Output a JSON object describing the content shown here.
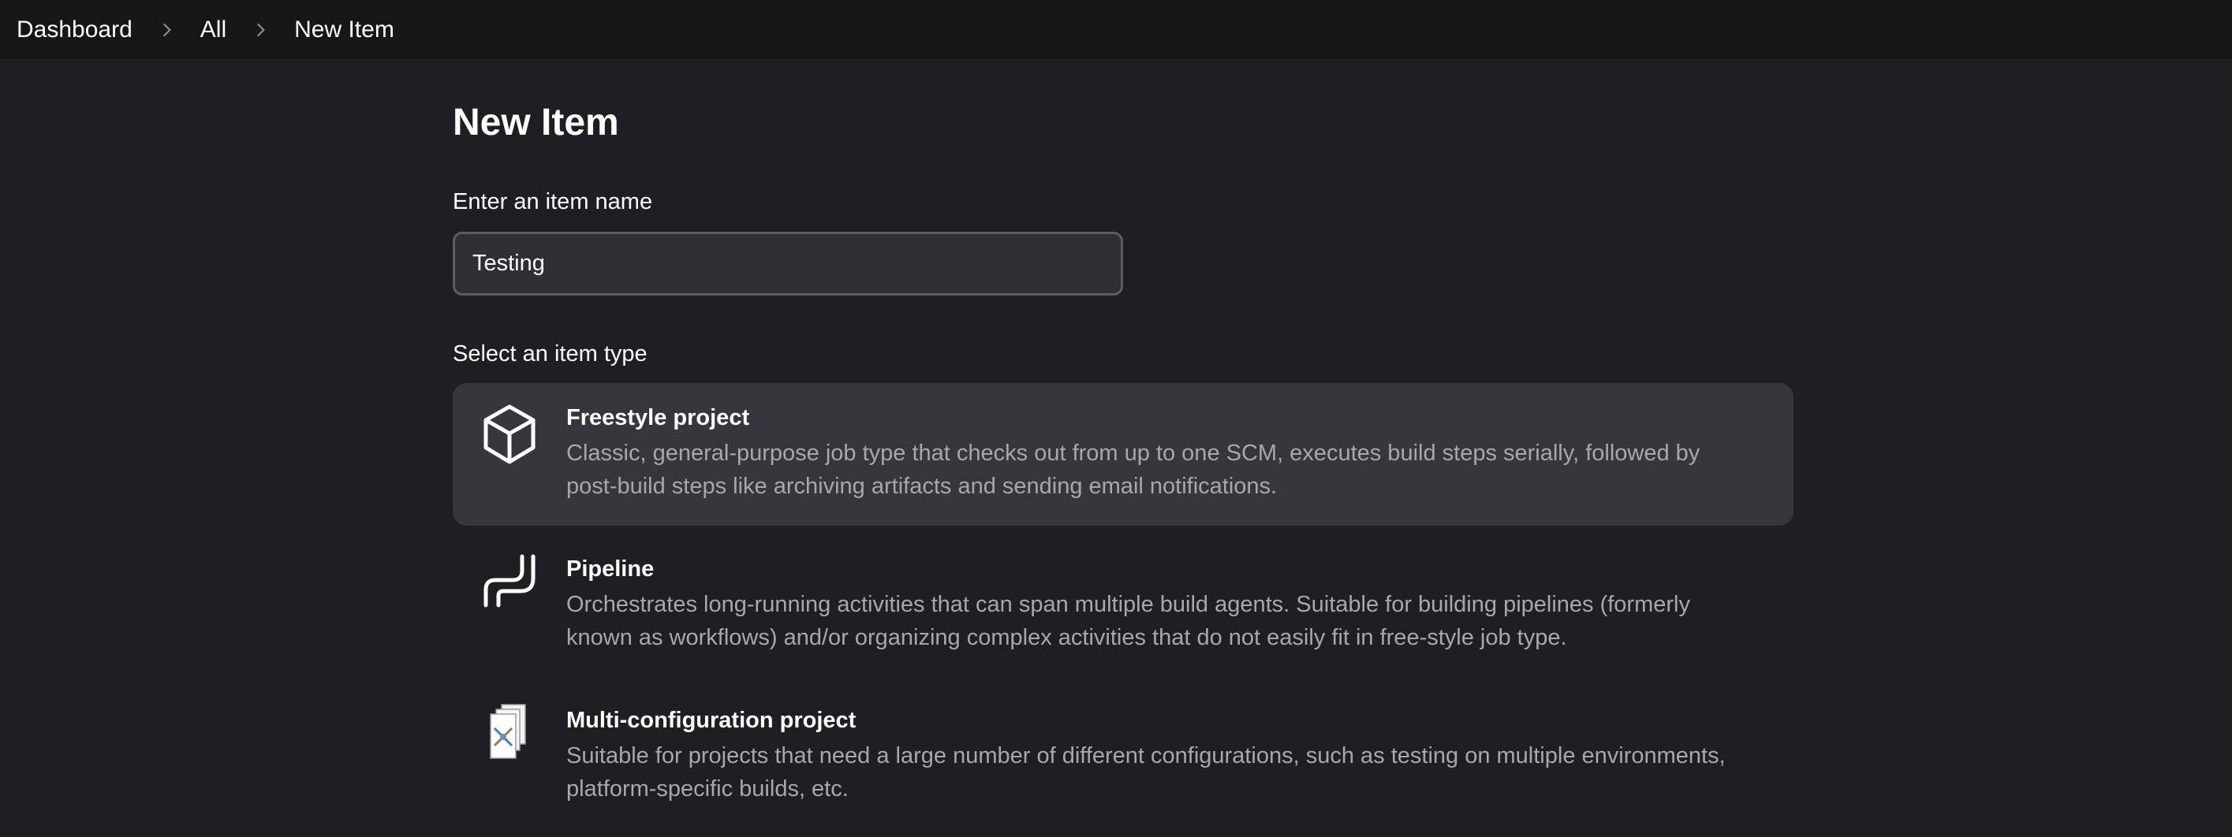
{
  "breadcrumb": {
    "items": [
      "Dashboard",
      "All",
      "New Item"
    ]
  },
  "page": {
    "title": "New Item"
  },
  "form": {
    "name_label": "Enter an item name",
    "name_value": "Testing",
    "type_label": "Select an item type"
  },
  "item_types": [
    {
      "title": "Freestyle project",
      "description": "Classic, general-purpose job type that checks out from up to one SCM, executes build steps serially, followed by post-build steps like archiving artifacts and sending email notifications.",
      "icon": "cube-icon",
      "selected": true
    },
    {
      "title": "Pipeline",
      "description": "Orchestrates long-running activities that can span multiple build agents. Suitable for building pipelines (formerly known as workflows) and/or organizing complex activities that do not easily fit in free-style job type.",
      "icon": "pipeline-icon",
      "selected": false
    },
    {
      "title": "Multi-configuration project",
      "description": "Suitable for projects that need a large number of different configurations, such as testing on multiple environments, platform-specific builds, etc.",
      "icon": "stacked-documents-icon",
      "selected": false
    }
  ],
  "colors": {
    "background": "#1f1f23",
    "topbar": "#17171a",
    "selected_item": "#36363d",
    "description_text": "#a7a7ae"
  }
}
